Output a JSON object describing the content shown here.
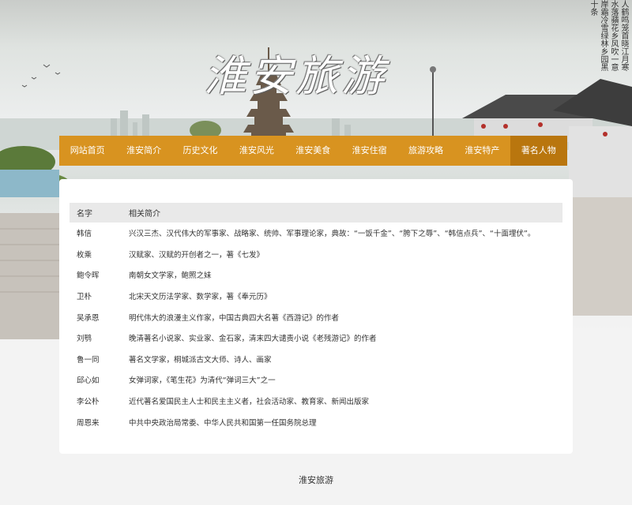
{
  "banner": {
    "title": "淮安旅游",
    "poem": "人鹤鸣笼首晓江月寒水落蘋花乡风吹一意岸霜冷雪绿林乡园黑十条"
  },
  "nav": {
    "items": [
      {
        "label": "网站首页"
      },
      {
        "label": "淮安简介"
      },
      {
        "label": "历史文化"
      },
      {
        "label": "淮安风光"
      },
      {
        "label": "淮安美食"
      },
      {
        "label": "淮安住宿"
      },
      {
        "label": "旅游攻略"
      },
      {
        "label": "淮安特产"
      },
      {
        "label": "著名人物"
      }
    ],
    "active_index": 8
  },
  "table": {
    "headers": {
      "name": "名字",
      "desc": "相关简介"
    },
    "rows": [
      {
        "name": "韩信",
        "desc": "兴汉三杰、汉代伟大的军事家、战略家、统帅、军事理论家，典故：“一饭千金”、“胯下之辱”、“韩信点兵”、“十面埋伏”。"
      },
      {
        "name": "枚乘",
        "desc": "汉赋家、汉赋的开创者之一，著《七发》"
      },
      {
        "name": "鲍令晖",
        "desc": "南朝女文学家，鲍照之妹"
      },
      {
        "name": "卫朴",
        "desc": "北宋天文历法学家、数学家，著《奉元历》"
      },
      {
        "name": "吴承恩",
        "desc": "明代伟大的浪漫主义作家，中国古典四大名著《西游记》的作者"
      },
      {
        "name": "刘鹗",
        "desc": "晚清著名小说家、实业家、金石家，清末四大谴责小说《老残游记》的作者"
      },
      {
        "name": "鲁一同",
        "desc": "著名文学家，桐城派古文大师、诗人、画家"
      },
      {
        "name": "邱心如",
        "desc": "女弹词家，《笔生花》为清代“弹词三大”之一"
      },
      {
        "name": "李公朴",
        "desc": "近代著名爱国民主人士和民主主义者，社会活动家、教育家、新闻出版家"
      },
      {
        "name": "周恩来",
        "desc": "中共中央政治局常委、中华人民共和国第一任国务院总理"
      }
    ]
  },
  "footer": {
    "text": "淮安旅游"
  },
  "colors": {
    "nav_bg": "#d89320",
    "nav_active": "#b9760e",
    "header_row": "#e9e9e9"
  }
}
